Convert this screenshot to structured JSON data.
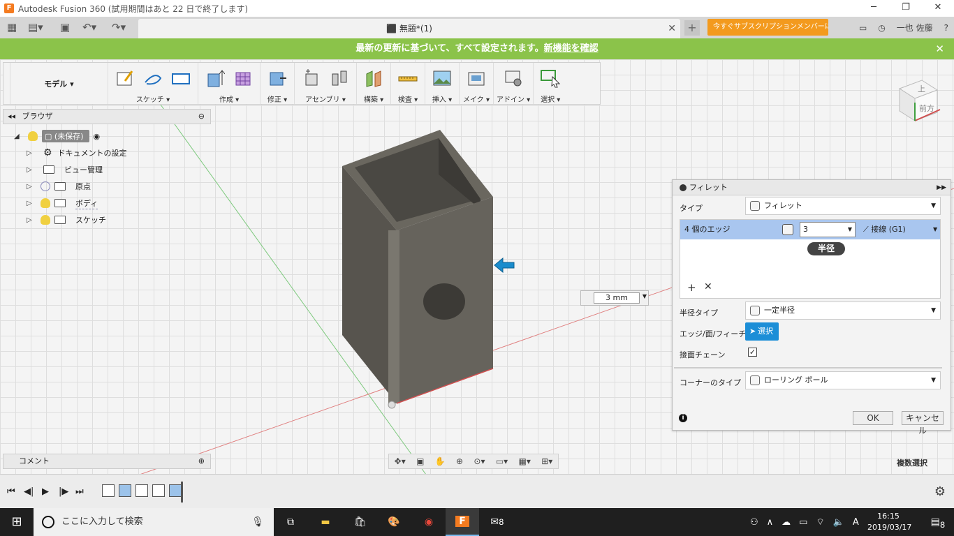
{
  "window": {
    "title": "Autodesk Fusion 360 (試用期間はあと 22 日で終了します)",
    "app_icon_letter": "F",
    "minimize_icon": "minimize-icon",
    "maximize_icon": "restore-icon",
    "close_glyph": "✕"
  },
  "tabbar": {
    "doc_title": "無題*(1)",
    "subscribe_label": "今すぐサブスクリプションメンバーに...",
    "user_name": "一也 佐藤",
    "close_glyph": "✕",
    "new_tab_glyph": "+"
  },
  "notice": {
    "text": "最新の更新に基づいて、すべて設定されます。",
    "link": "新機能を確認",
    "close_glyph": "✕"
  },
  "toolbar": {
    "workspace": "モデル ▾",
    "groups": [
      {
        "label": "スケッチ ▾"
      },
      {
        "label": "作成 ▾"
      },
      {
        "label": "修正 ▾"
      },
      {
        "label": "アセンブリ ▾"
      },
      {
        "label": "構築 ▾"
      },
      {
        "label": "検査 ▾"
      },
      {
        "label": "挿入 ▾"
      },
      {
        "label": "メイク ▾"
      },
      {
        "label": "アドイン ▾"
      },
      {
        "label": "選択 ▾"
      }
    ]
  },
  "browser": {
    "title": "ブラウザ",
    "root": "(未保存)",
    "items": [
      {
        "label": "ドキュメントの設定"
      },
      {
        "label": "ビュー管理"
      },
      {
        "label": "原点"
      },
      {
        "label": "ボディ"
      },
      {
        "label": "スケッチ"
      }
    ]
  },
  "comment": {
    "label": "コメント"
  },
  "fillet": {
    "title": "フィレット",
    "type_label": "タイプ",
    "type_value": "フィレット",
    "edges_label": "4 個のエッジ",
    "radius_value": "3",
    "tangency_value": "接線 (G1)",
    "radius_pill": "半径",
    "radius_type_label": "半径タイプ",
    "radius_type_value": "一定半径",
    "edge_face_label": "エッジ/面/フィーチャ",
    "select_label": "選択",
    "chain_label": "接面チェーン",
    "chain_checked": true,
    "corner_label": "コーナーのタイプ",
    "corner_value": "ローリング ボール",
    "ok_label": "OK",
    "cancel_label": "キャンセル"
  },
  "dimension_input": "3 mm",
  "viewcube": {
    "top": "上",
    "front": "前方"
  },
  "status": {
    "multi_select": "複数選択"
  },
  "taskbar": {
    "search_placeholder": "ここに入力して検索",
    "time": "16:15",
    "date": "2019/03/17",
    "mail_badge": "8",
    "notif_badge": "8",
    "ime": "A"
  },
  "colors": {
    "notice_bg": "#8bc34a",
    "subscribe_bg": "#f39a1e",
    "select_btn": "#1c8ed7",
    "edge_row": "#a9c6ef",
    "model_body": "#5e5b55"
  }
}
